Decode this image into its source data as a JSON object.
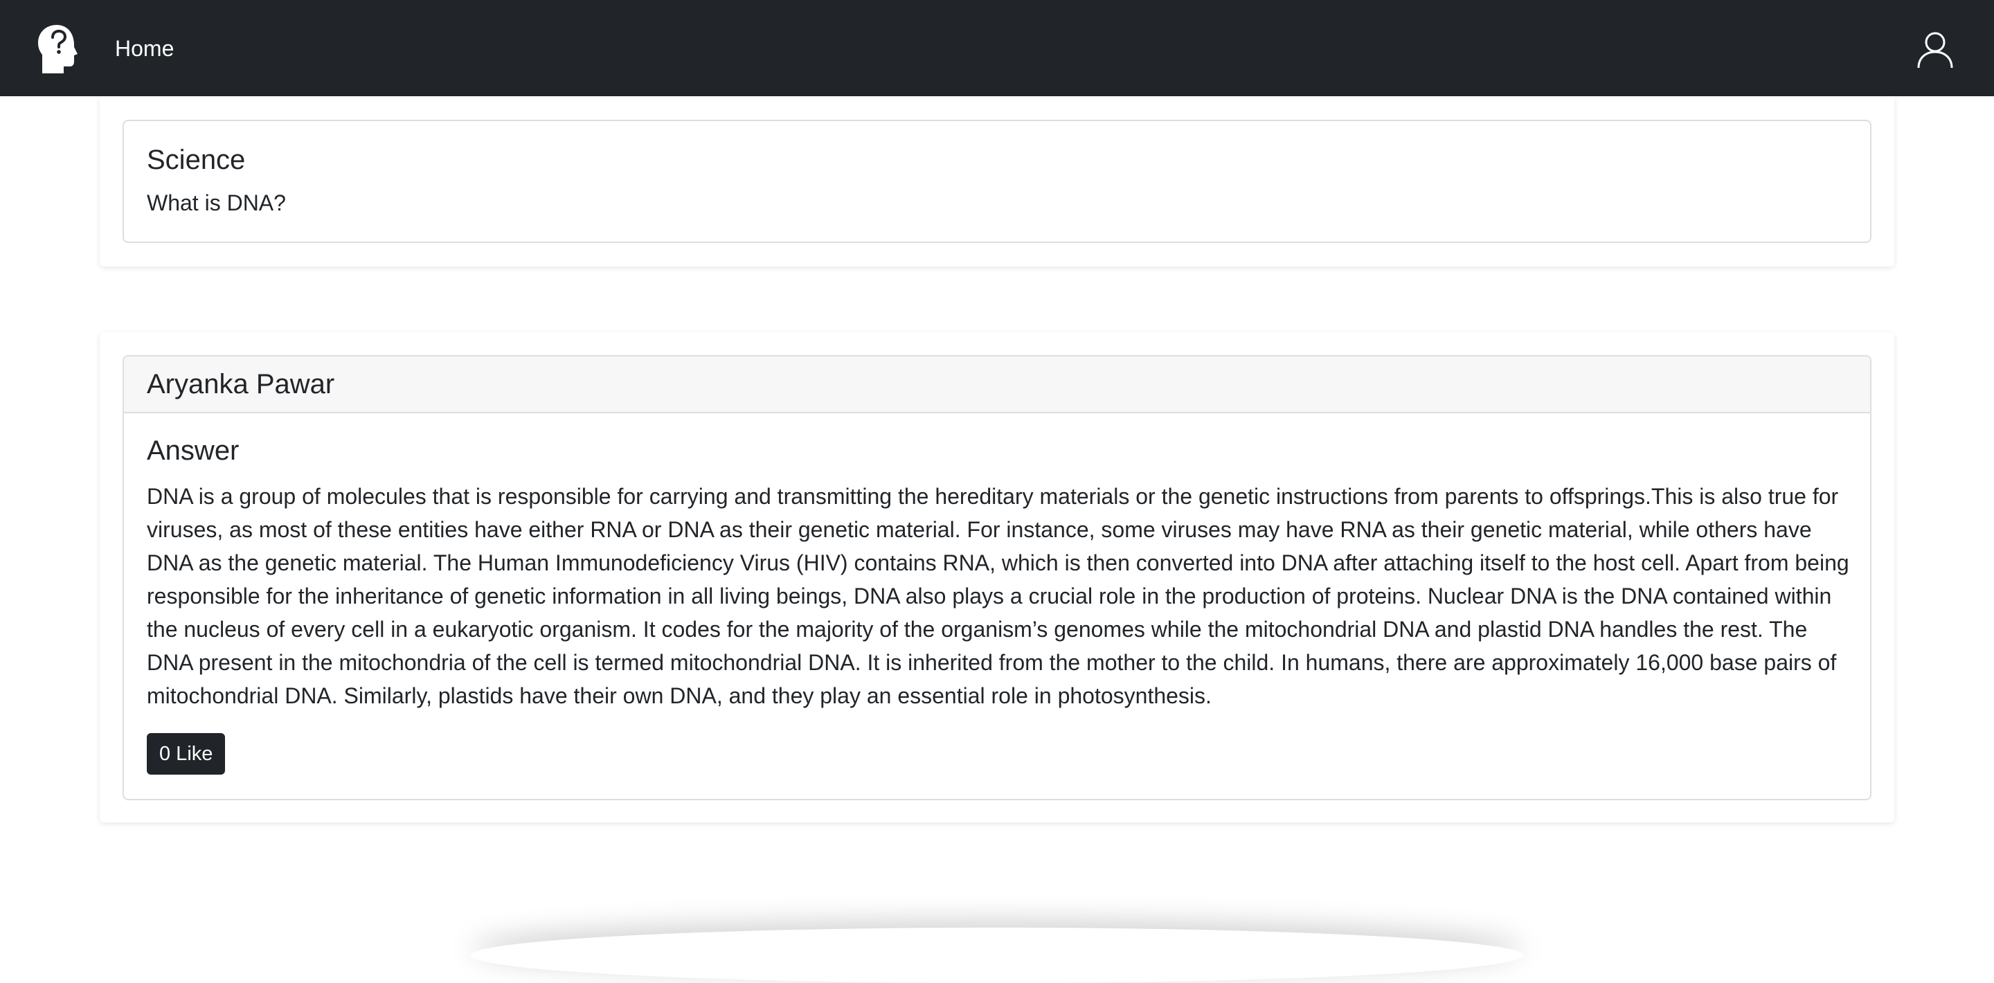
{
  "nav": {
    "logo_icon": "head-question-icon",
    "home_label": "Home",
    "user_icon": "user-icon"
  },
  "question": {
    "category": "Science",
    "text": "What is DNA?"
  },
  "answer": {
    "author": "Aryanka Pawar",
    "title": "Answer",
    "body": "DNA is a group of molecules that is responsible for carrying and transmitting the hereditary materials or the genetic instructions from parents to offsprings.This is also true for viruses, as most of these entities have either RNA or DNA as their genetic material. For instance, some viruses may have RNA as their genetic material, while others have DNA as the genetic material. The Human Immunodeficiency Virus (HIV) contains RNA, which is then converted into DNA after attaching itself to the host cell. Apart from being responsible for the inheritance of genetic information in all living beings, DNA also plays a crucial role in the production of proteins. Nuclear DNA is the DNA contained within the nucleus of every cell in a eukaryotic organism. It codes for the majority of the organism’s genomes while the mitochondrial DNA and plastid DNA handles the rest. The DNA present in the mitochondria of the cell is termed mitochondrial DNA. It is inherited from the mother to the child. In humans, there are approximately 16,000 base pairs of mitochondrial DNA. Similarly, plastids have their own DNA, and they play an essential role in photosynthesis.",
    "like_label": "0 Like"
  },
  "colors": {
    "navbar_bg": "#212529",
    "button_bg": "#212529",
    "header_bg": "#f7f7f7"
  }
}
